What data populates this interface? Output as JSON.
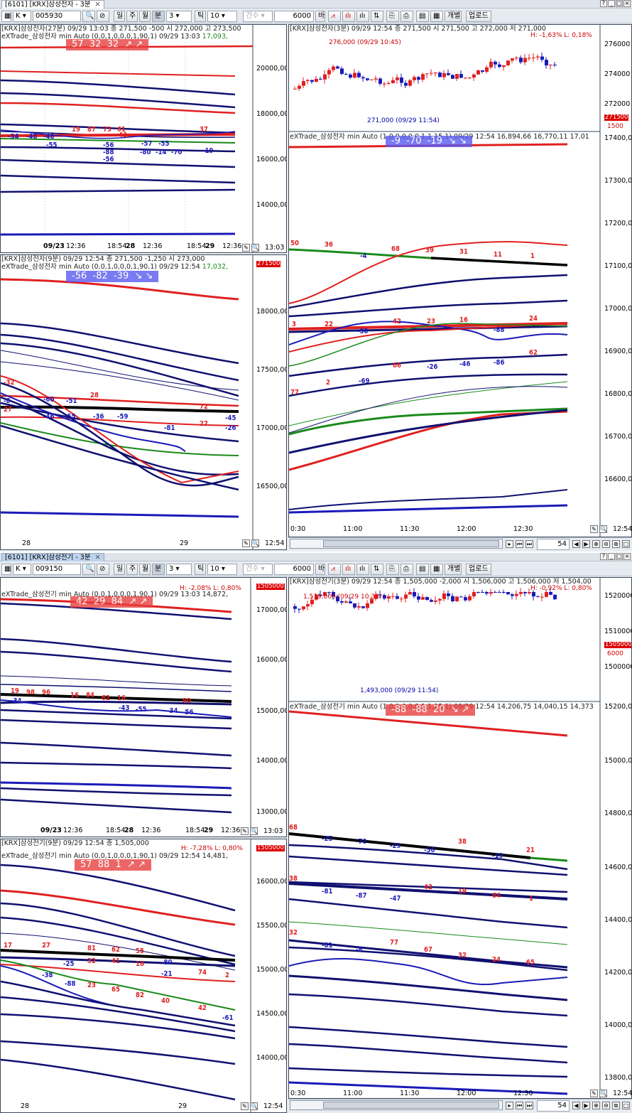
{
  "top": {
    "tab_title": "[6101] [KRX]삼성전자 - 3분",
    "code": "005930",
    "market": "K",
    "period_buttons": [
      "일",
      "주",
      "월",
      "분"
    ],
    "minute_value": "3",
    "tick_label": "틱",
    "tick_value": "10",
    "count_label": "건수",
    "count_value": "6000",
    "bar_label": "바",
    "individual_label": "개별",
    "upload_label": "업로드",
    "left_upper": {
      "hdr1": "[KRX]삼성전자(27분) 09/29 13:03   종 271,500  -500  시 272,000 고 273,500",
      "hdr2": "eXTrade_삼성전자 min Auto  (0,0,1,0,0,0,1,90,1) 09/29 13:03",
      "hdr2_green": "17,093,",
      "signal": "57  32  32  ↗ ↗",
      "yticks": [
        "20000,00",
        "18000,00",
        "16000,00",
        "14000,00"
      ],
      "xticks": [
        "09/23",
        "12:36",
        "18:54",
        "28",
        "12:36",
        "18:54",
        "29",
        "12:36"
      ],
      "time": "13:03",
      "labels_red": [
        "19",
        "87",
        "73",
        "61",
        "43",
        "37"
      ],
      "labels_blue": [
        "-34",
        "-48",
        "-48",
        "-56",
        "-55",
        "-88",
        "-56",
        "-19",
        "-70",
        "-14",
        "-80",
        "-57",
        "-55"
      ]
    },
    "left_lower": {
      "hdr1": "[KRX]삼성전자(9분) 09/29 12:54   종 271,500  -1,250  시 273,000",
      "hdr2": "eXTrade_삼성전자 min Auto  (0,0,1,0,0,0,1,90,1) 09/29 12:54",
      "hdr2_green": "17,032,",
      "price_tag": "271500",
      "signal": "-56  -82  -39  ↘ ↘",
      "yticks": [
        "18000,00",
        "17500,00",
        "17000,00",
        "16500,00"
      ],
      "xticks": [
        "28",
        "29"
      ],
      "time": "12:54",
      "labels_red": [
        "28",
        "72",
        "22",
        "-32",
        "27"
      ],
      "labels_blue": [
        "-60",
        "-51",
        "-46",
        "-55",
        "-36",
        "-59",
        "-81",
        "-45",
        "-26",
        "-8"
      ]
    },
    "right": {
      "hdr1": "[KRX]삼성전자(3분) 09/29 12:54   종 271,500   시 271,500 고 272,000 저 271,000",
      "hl": "H: -1,63%   L: 0,18%",
      "high_label": "276,000 (09/29 10:45)",
      "low_label": "271,000 (09/29 11:54)",
      "price_tag": "271500",
      "price_tag2": "1500",
      "price_yticks": [
        "276000",
        "274000",
        "272000"
      ],
      "hdr2": "eXTrade_삼성전자 min Auto  (1,0,0,0,0,0,1,1,15,1) 09/29 12:54",
      "hdr2_vals": "16,894,66 16,770,11 17,01",
      "signal": "-9  -70  -19  ↘ ↘",
      "yticks": [
        "17400,00",
        "17300,00",
        "17200,00",
        "17100,00",
        "17000,00",
        "16900,00",
        "16800,00",
        "16700,00",
        "16600,00"
      ],
      "xticks": [
        "0:30",
        "11:00",
        "11:30",
        "12:00",
        "12:30"
      ],
      "time": "12:54",
      "scroll_value": "54",
      "labels_red": [
        "50",
        "36",
        "68",
        "39",
        "31",
        "11",
        "1",
        "3",
        "22",
        "42",
        "23",
        "16",
        "24",
        "62",
        "66",
        "77",
        "2"
      ],
      "labels_blue": [
        "-4",
        "-30",
        "-88",
        "-26",
        "-46",
        "-86",
        "-69"
      ]
    }
  },
  "bottom": {
    "tab_title": "[6101] [KRX]삼성전기 - 3분",
    "code": "009150",
    "market": "K",
    "minute_value": "3",
    "tick_value": "10",
    "count_label": "건수",
    "count_value": "6000",
    "bar_label": "바",
    "individual_label": "개별",
    "upload_label": "업로드",
    "left_upper": {
      "hdr2": "eXTrade_삼성전기 min Auto  (0,0,1,0,0,0,1,90,1) 09/29 13:03",
      "hdr2_vals": "14,872,",
      "hl": "H: -2,08%   L: 0,80%",
      "price_tag": "1505000",
      "signal": "42  29  84  ↗ ↗",
      "yticks": [
        "17000,00",
        "16000,00",
        "15000,00",
        "14000,00",
        "13000,00"
      ],
      "xticks": [
        "09/23",
        "12:36",
        "18:54",
        "28",
        "12:36",
        "18:54",
        "29",
        "12:36"
      ],
      "time": "13:03",
      "labels_red": [
        "19",
        "98",
        "96",
        "16",
        "84",
        "62",
        "16",
        "80"
      ],
      "labels_blue": [
        "-34",
        "-43",
        "-55",
        "-34",
        "-56"
      ]
    },
    "left_lower": {
      "hdr1": "[KRX]삼성전기(9분) 09/29 12:54   종 1,505,000",
      "hdr2": "eXTrade_삼성전기 min Auto  (0,0,1,0,0,0,1,90,1) 09/29 12:54",
      "hdr2_vals": "14,481,",
      "hl": "H: -7,28%   L: 0,80%",
      "price_tag": "1505000",
      "signal": "57  88  1  ↗ ↗",
      "yticks": [
        "16000,00",
        "15500,00",
        "15000,00",
        "14500,00",
        "14000,00"
      ],
      "xticks": [
        "28",
        "29"
      ],
      "time": "12:54",
      "labels_red": [
        "17",
        "27",
        "81",
        "62",
        "55",
        "41",
        "18",
        "74",
        "2",
        "65",
        "82",
        "40",
        "42",
        "23",
        "32"
      ],
      "labels_blue": [
        "-25",
        "-88",
        "-21",
        "-61",
        "-38",
        "-80"
      ]
    },
    "right": {
      "hdr1": "[KRX]삼성전기(3분) 09/29 12:54   종 1,505,000  -2,000   시 1,506,000 고 1,506,000 저 1,504,00",
      "hl": "H: -0,92%   L: 0,80%",
      "high_label": "1,519,000 (09/29 10:33)",
      "low_label": "1,493,000 (09/29 11:54)",
      "price_tag": "1505000",
      "price_tag2": "6000",
      "price_yticks": [
        "1520000",
        "1510000",
        "1500000"
      ],
      "hdr2": "eXTrade_삼성전기 min Auto  (1,0,0,0,0,0,1,1,15,1) 09/29 12:54",
      "hdr2_vals": "14,206,75 14,040,15 14,373",
      "signal": "-88  -88  20  ↘ ↗",
      "yticks": [
        "15200,00",
        "15000,00",
        "14800,00",
        "14600,00",
        "14400,00",
        "14200,00",
        "14000,00",
        "13800,00"
      ],
      "xticks": [
        "0:30",
        "11:00",
        "11:30",
        "12:00",
        "12:30"
      ],
      "time": "12:54",
      "scroll_value": "54",
      "labels_red": [
        "68",
        "38",
        "21",
        "38",
        "42",
        "19",
        "64",
        "1",
        "32",
        "77",
        "67",
        "32",
        "24",
        "65"
      ],
      "labels_blue": [
        "-25",
        "-70",
        "-29",
        "-56",
        "-19",
        "-81",
        "-87",
        "-47",
        "-81",
        "-8"
      ]
    }
  },
  "colors": {
    "red": "#e02020",
    "blue": "#1a1ab8",
    "navy": "#101070",
    "green": "#1a8a1a",
    "black": "#000000"
  },
  "icons": [
    "search-icon",
    "zoom-icon",
    "close-icon",
    "window-buttons"
  ]
}
